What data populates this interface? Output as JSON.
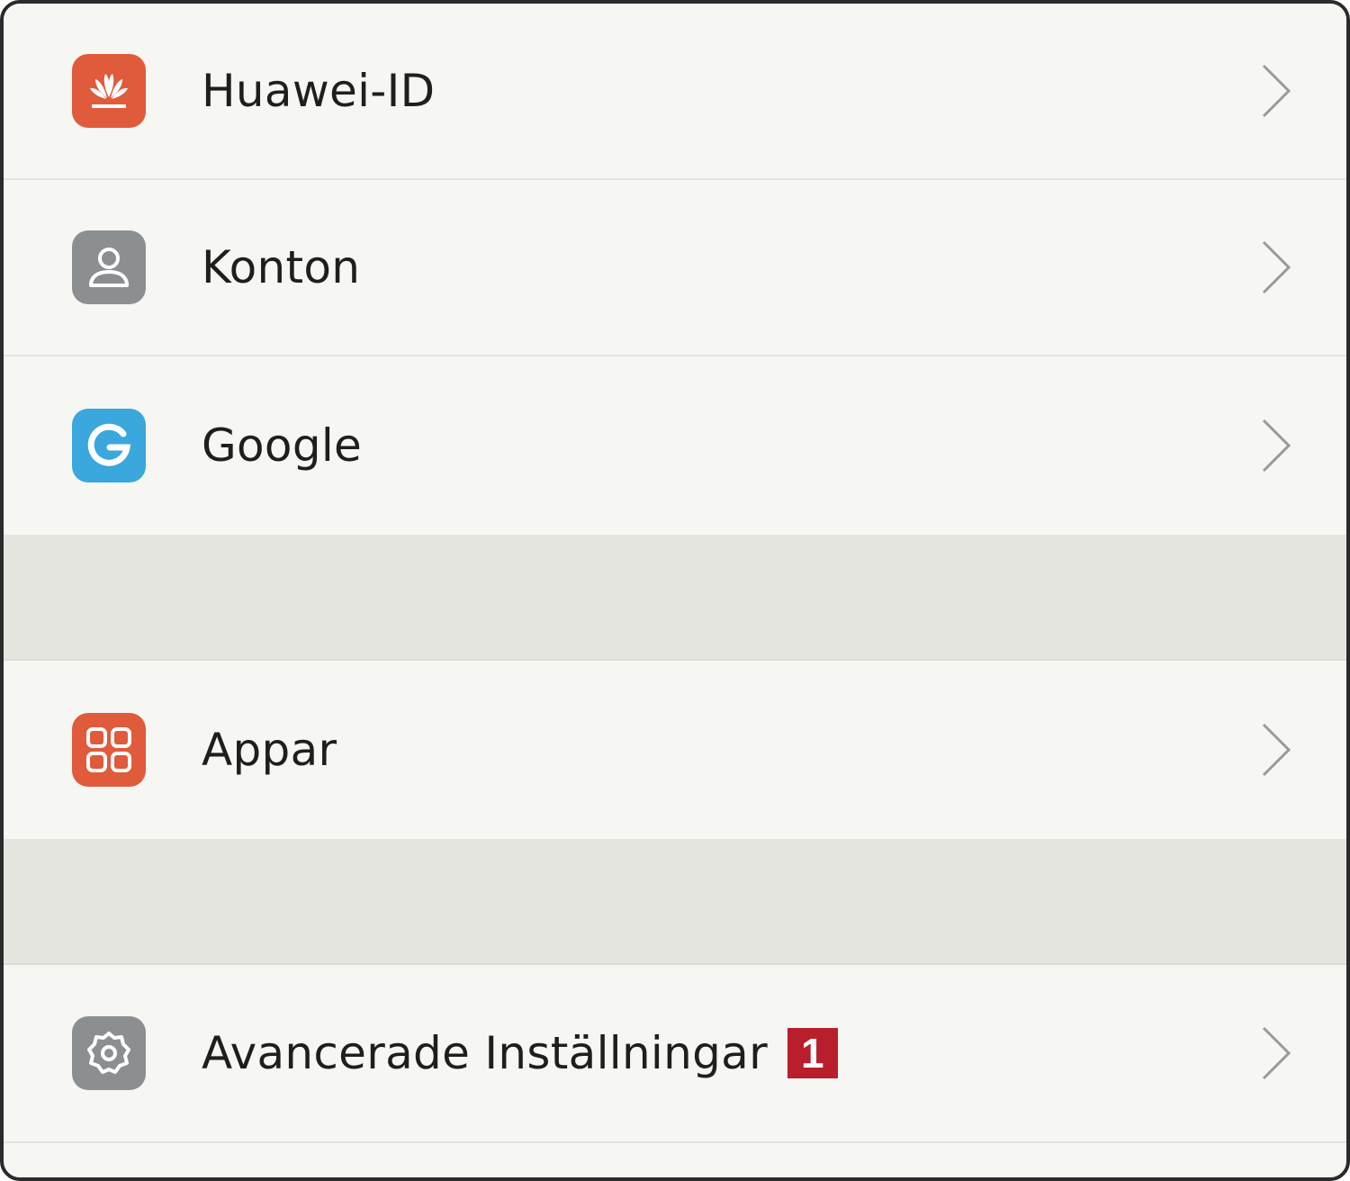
{
  "settings": {
    "items": [
      {
        "label": "Huawei-ID",
        "icon": "huawei-logo-icon",
        "icon_color": "#e05a3c"
      },
      {
        "label": "Konton",
        "icon": "user-icon",
        "icon_color": "#8b8f91"
      },
      {
        "label": "Google",
        "icon": "google-g-icon",
        "icon_color": "#3aa7dd"
      },
      {
        "label": "Appar",
        "icon": "apps-grid-icon",
        "icon_color": "#e05a3c"
      },
      {
        "label": "Avancerade Inställningar",
        "icon": "gear-icon",
        "icon_color": "#8b8f91",
        "badge": "1",
        "badge_color": "#b81e2b"
      }
    ]
  }
}
